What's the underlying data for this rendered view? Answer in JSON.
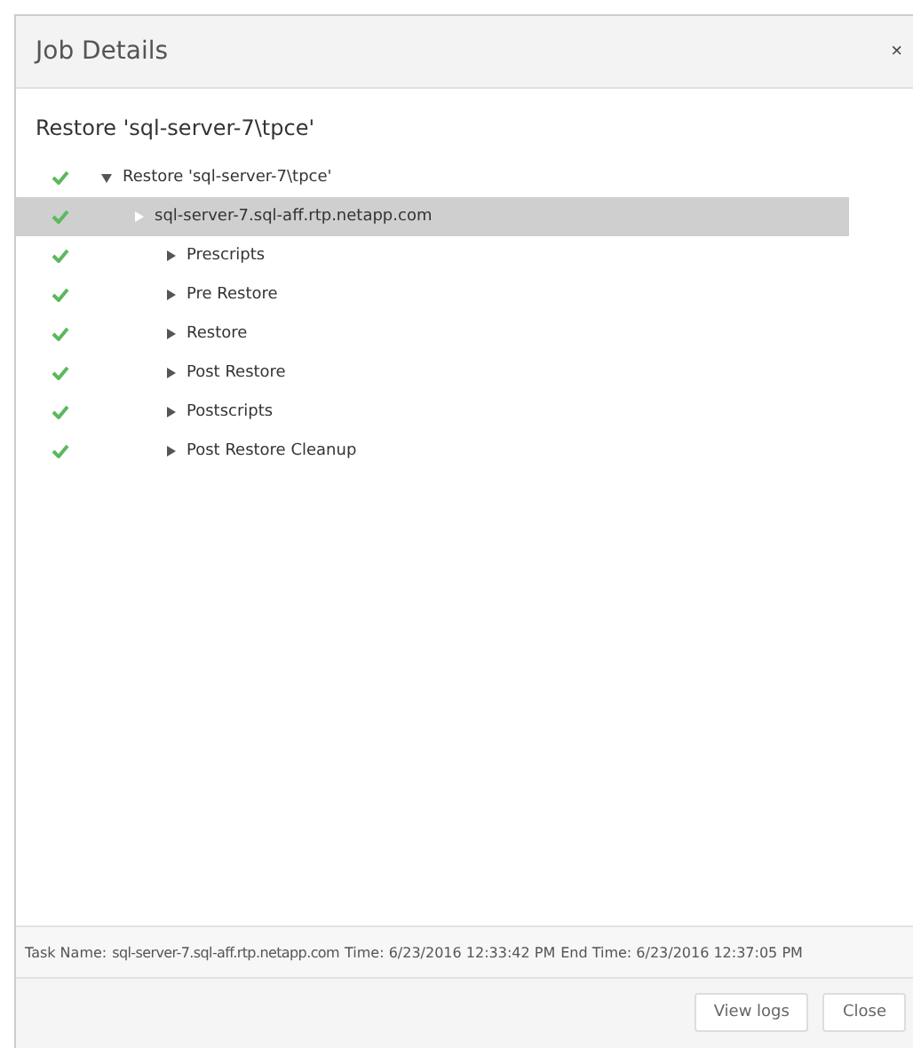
{
  "dialog": {
    "title": "Job Details",
    "close": "×"
  },
  "heading": "Restore 'sql-server-7\\tpce'",
  "tree": [
    {
      "label": "Restore 'sql-server-7\\tpce'",
      "done": true,
      "expanded": true,
      "selected": false,
      "children": [
        {
          "label": "sql-server-7.sql-aff.rtp.netapp.com",
          "done": true,
          "expanded": false,
          "selected": true,
          "children": [
            {
              "label": "Prescripts",
              "done": true,
              "expanded": false,
              "selected": false
            },
            {
              "label": "Pre Restore",
              "done": true,
              "expanded": false,
              "selected": false
            },
            {
              "label": "Restore",
              "done": true,
              "expanded": false,
              "selected": false
            },
            {
              "label": "Post Restore",
              "done": true,
              "expanded": false,
              "selected": false
            },
            {
              "label": "Postscripts",
              "done": true,
              "expanded": false,
              "selected": false
            },
            {
              "label": "Post Restore Cleanup",
              "done": true,
              "expanded": false,
              "selected": false
            }
          ]
        }
      ]
    }
  ],
  "status_bar": {
    "task_label": "Task Name:",
    "task_name": "sql-server-7.sql-aff.rtp.netapp.com",
    "time": "Time: 6/23/2016 12:33:42 PM",
    "end_time": "End Time: 6/23/2016 12:37:05 PM"
  },
  "buttons": [
    "View logs",
    "Close"
  ]
}
